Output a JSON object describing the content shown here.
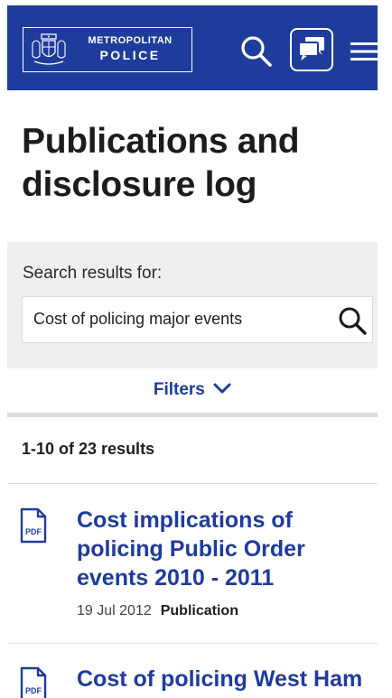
{
  "header": {
    "logo_line1": "METROPOLITAN",
    "logo_line2": "POLICE",
    "brand_color": "#1e3c9c",
    "icons": [
      "crest-icon",
      "search-icon",
      "chat-icon",
      "hamburger-menu-icon"
    ]
  },
  "page": {
    "title": "Publications and disclosure log"
  },
  "search": {
    "label": "Search results for:",
    "value": "Cost of policing major events"
  },
  "filters": {
    "label": "Filters"
  },
  "results": {
    "count_text": "1-10 of 23 results",
    "items": [
      {
        "icon": "pdf-icon",
        "icon_text": "PDF",
        "title": "Cost implications of policing Public Order events 2010 - 2011",
        "date": "19 Jul 2012",
        "type": "Publication"
      },
      {
        "icon": "pdf-icon",
        "icon_text": "PDF",
        "title": "Cost of policing West Ham"
      }
    ]
  }
}
